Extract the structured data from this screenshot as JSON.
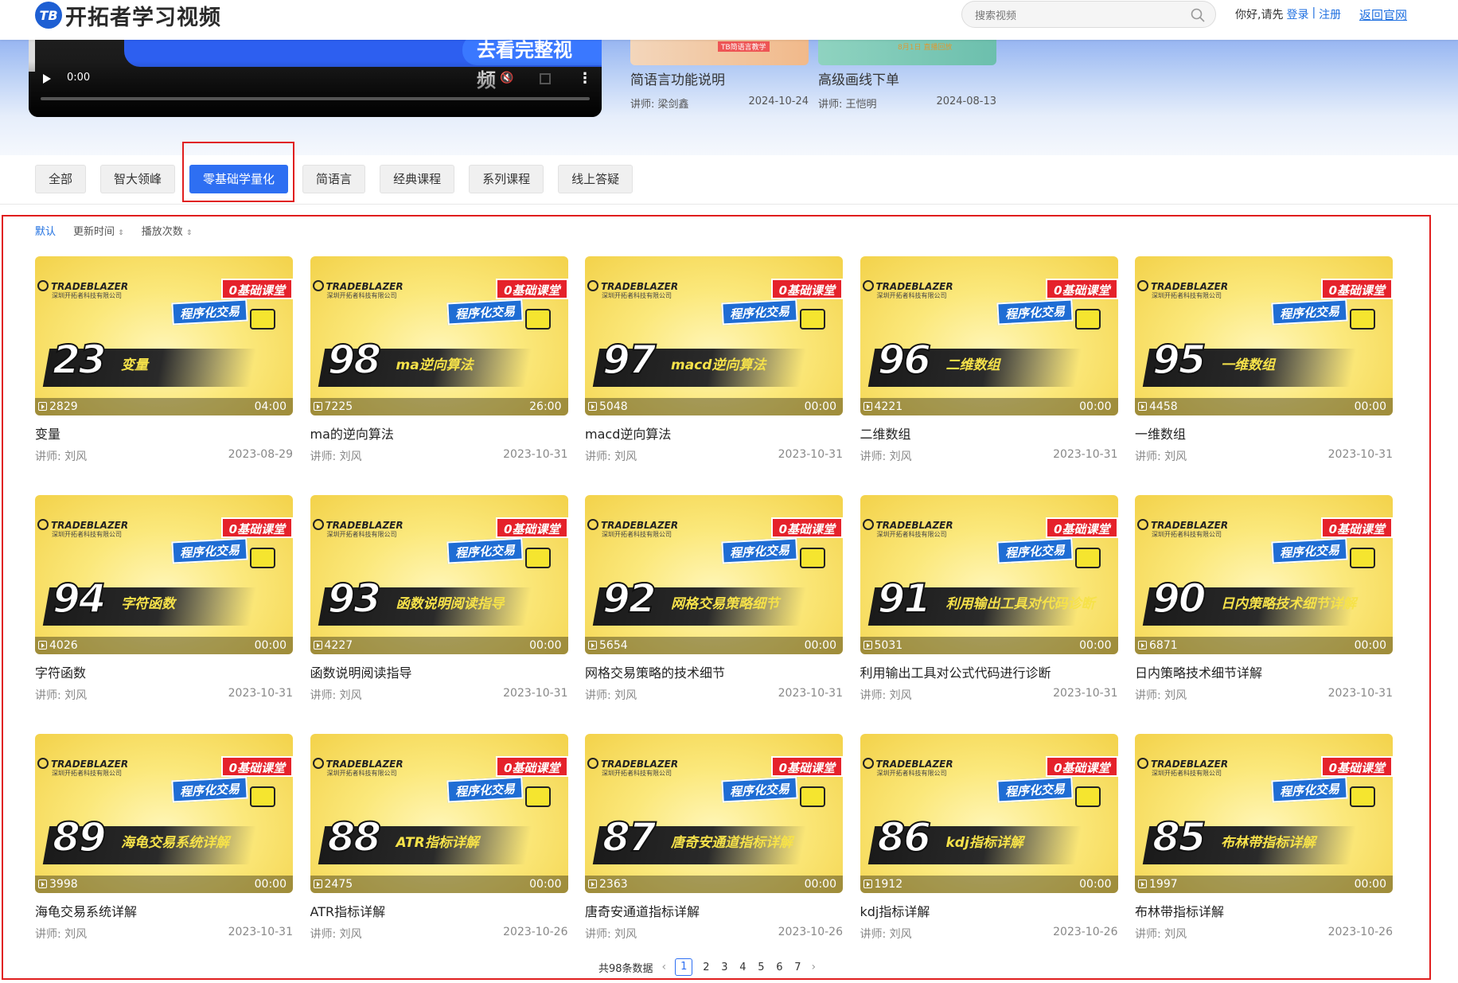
{
  "header": {
    "logo_mark": "TB",
    "logo_text": "开拓者学习视频",
    "search_placeholder": "搜索视频",
    "greeting": "你好,请先",
    "login": "登录",
    "separator": "|",
    "register": "注册",
    "back_home": "返回官网"
  },
  "player": {
    "watch_full": "去看完整视频",
    "time": "0:00"
  },
  "recent": [
    {
      "title": "简语言功能说明",
      "teacher": "讲师: 梁剑鑫",
      "date": "2024-10-24",
      "color": "#f5c9a0"
    },
    {
      "title": "高级画线下单",
      "teacher": "讲师: 王恺明",
      "date": "2024-08-13",
      "color": "#7fcab8"
    }
  ],
  "tabs": [
    "全部",
    "智大领峰",
    "零基础学量化",
    "简语言",
    "经典课程",
    "系列课程",
    "线上答疑"
  ],
  "active_tab": 2,
  "sort": {
    "default": "默认",
    "updated": "更新时间",
    "plays": "播放次数",
    "arrow": "⇕"
  },
  "videos": [
    {
      "num": "23",
      "label": "变量",
      "plays": "2829",
      "duration": "04:00",
      "title": "变量",
      "teacher": "讲师: 刘风",
      "date": "2023-08-29"
    },
    {
      "num": "98",
      "label": "ma逆向算法",
      "plays": "7225",
      "duration": "26:00",
      "title": "ma的逆向算法",
      "teacher": "讲师: 刘风",
      "date": "2023-10-31"
    },
    {
      "num": "97",
      "label": "macd逆向算法",
      "plays": "5048",
      "duration": "00:00",
      "title": "macd逆向算法",
      "teacher": "讲师: 刘风",
      "date": "2023-10-31"
    },
    {
      "num": "96",
      "label": "二维数组",
      "plays": "4221",
      "duration": "00:00",
      "title": "二维数组",
      "teacher": "讲师: 刘风",
      "date": "2023-10-31"
    },
    {
      "num": "95",
      "label": "一维数组",
      "plays": "4458",
      "duration": "00:00",
      "title": "一维数组",
      "teacher": "讲师: 刘风",
      "date": "2023-10-31"
    },
    {
      "num": "94",
      "label": "字符函数",
      "plays": "4026",
      "duration": "00:00",
      "title": "字符函数",
      "teacher": "讲师: 刘风",
      "date": "2023-10-31"
    },
    {
      "num": "93",
      "label": "函数说明阅读指导",
      "plays": "4227",
      "duration": "00:00",
      "title": "函数说明阅读指导",
      "teacher": "讲师: 刘风",
      "date": "2023-10-31"
    },
    {
      "num": "92",
      "label": "网格交易策略细节",
      "plays": "5654",
      "duration": "00:00",
      "title": "网格交易策略的技术细节",
      "teacher": "讲师: 刘风",
      "date": "2023-10-31"
    },
    {
      "num": "91",
      "label": "利用输出工具对代码诊断",
      "plays": "5031",
      "duration": "00:00",
      "title": "利用输出工具对公式代码进行诊断",
      "teacher": "讲师: 刘风",
      "date": "2023-10-31"
    },
    {
      "num": "90",
      "label": "日内策略技术细节详解",
      "plays": "6871",
      "duration": "00:00",
      "title": "日内策略技术细节详解",
      "teacher": "讲师: 刘风",
      "date": "2023-10-31"
    },
    {
      "num": "89",
      "label": "海龟交易系统详解",
      "plays": "3998",
      "duration": "00:00",
      "title": "海龟交易系统详解",
      "teacher": "讲师: 刘风",
      "date": "2023-10-31"
    },
    {
      "num": "88",
      "label": "ATR指标详解",
      "plays": "2475",
      "duration": "00:00",
      "title": "ATR指标详解",
      "teacher": "讲师: 刘风",
      "date": "2023-10-26"
    },
    {
      "num": "87",
      "label": "唐奇安通道指标详解",
      "plays": "2363",
      "duration": "00:00",
      "title": "唐奇安通道指标详解",
      "teacher": "讲师: 刘风",
      "date": "2023-10-26"
    },
    {
      "num": "86",
      "label": "kdj指标详解",
      "plays": "1912",
      "duration": "00:00",
      "title": "kdj指标详解",
      "teacher": "讲师: 刘风",
      "date": "2023-10-26"
    },
    {
      "num": "85",
      "label": "布林带指标详解",
      "plays": "1997",
      "duration": "00:00",
      "title": "布林带指标详解",
      "teacher": "讲师: 刘风",
      "date": "2023-10-26"
    }
  ],
  "thumb_text": {
    "brand": "TRADEBLAZER",
    "brand_sub": "深圳开拓者科技有限公司",
    "badge1": "0基础课堂",
    "badge2": "程序化交易"
  },
  "pagination": {
    "total": "共98条数据",
    "prev": "‹",
    "next": "›",
    "pages": [
      "1",
      "2",
      "3",
      "4",
      "5",
      "6",
      "7"
    ],
    "current": "1"
  },
  "colors": {
    "accent": "#2e6ff2",
    "highlight": "#e01e1e"
  }
}
